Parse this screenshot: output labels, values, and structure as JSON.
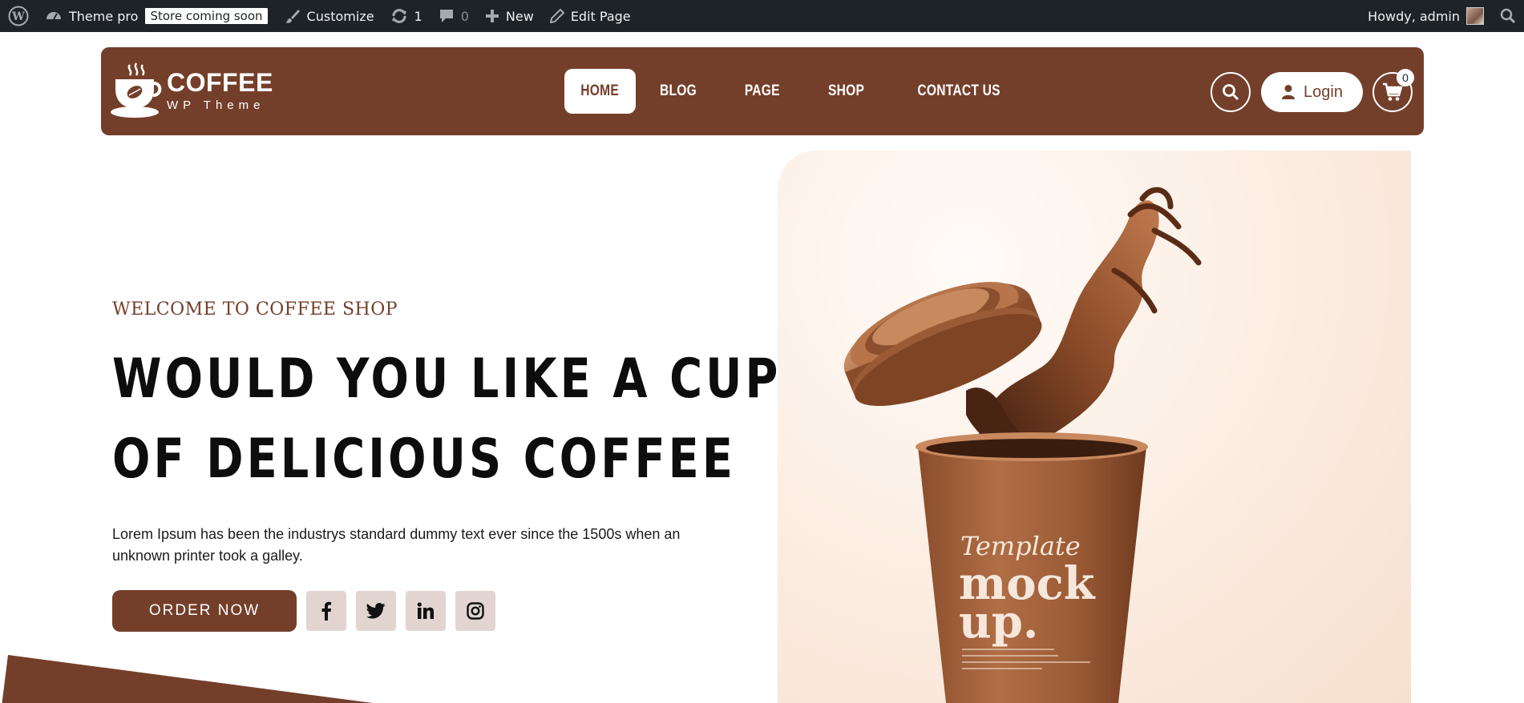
{
  "adminbar": {
    "site_name": "Theme pro",
    "badge": "Store coming soon",
    "customize": "Customize",
    "updates_count": "1",
    "comments_count": "0",
    "new_label": "New",
    "edit_label": "Edit Page",
    "howdy": "Howdy, admin"
  },
  "header": {
    "logo_title": "COFFEE",
    "logo_subtitle": "WP Theme",
    "nav": [
      "HOME",
      "BLOG",
      "PAGE",
      "SHOP",
      "CONTACT US"
    ],
    "login_label": "Login",
    "cart_count": "0"
  },
  "hero": {
    "welcome": "WELCOME TO COFFEE SHOP",
    "title_line1": "WOULD YOU LIKE A CUP",
    "title_line2": "OF DELICIOUS COFFEE",
    "description": "Lorem Ipsum has been the industrys standard dummy text ever since the 1500s when an unknown printer took a galley.",
    "order_button": "ORDER NOW",
    "socials": [
      "facebook-icon",
      "twitter-icon",
      "linkedin-icon",
      "instagram-icon"
    ]
  },
  "mockup": {
    "script_text": "Template",
    "bold_text_1": "mock",
    "bold_text_2": "up."
  },
  "colors": {
    "brand": "#743f2a",
    "adminbar": "#1d2327",
    "social_bg": "#e2d5d1"
  }
}
